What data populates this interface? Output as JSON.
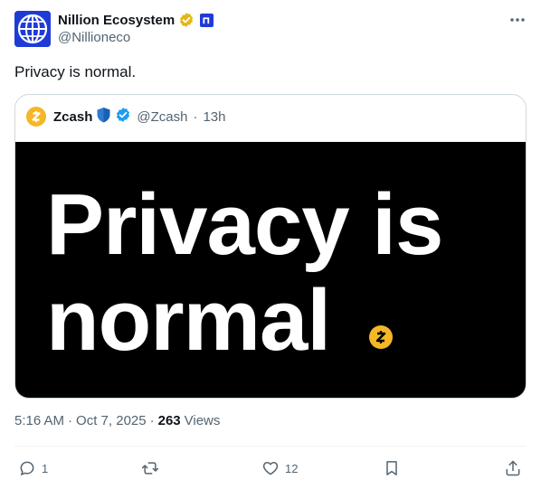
{
  "author": {
    "display_name": "Nillion Ecosystem",
    "handle": "@Nillioneco",
    "avatar_icon": "globe-grid-logo",
    "badge_icon": "gold-verified-badge",
    "affiliate_icon": "nillion-affiliate-badge"
  },
  "post": {
    "text": "Privacy is normal."
  },
  "quoted": {
    "display_name": "Zcash",
    "handle": "@Zcash",
    "separator": "·",
    "time_ago": "13h",
    "avatar_icon": "zcash-logo",
    "badges": [
      "blue-shield-emoji",
      "blue-verified-badge"
    ],
    "image": {
      "line1": "Privacy is",
      "line2": "normal",
      "dot_icon": "zcash-coin-icon"
    }
  },
  "meta": {
    "time": "5:16 AM",
    "sep1": "·",
    "date": "Oct 7, 2025",
    "sep2": "·",
    "views_count": "263",
    "views_label": "Views"
  },
  "actions": {
    "reply_count": "1",
    "repost_count": "",
    "like_count": "12"
  },
  "colors": {
    "brand_blue": "#1f3bd6",
    "zcash_gold": "#f4b728",
    "secondary_text": "#536471",
    "verified_blue": "#1d9bf0"
  }
}
